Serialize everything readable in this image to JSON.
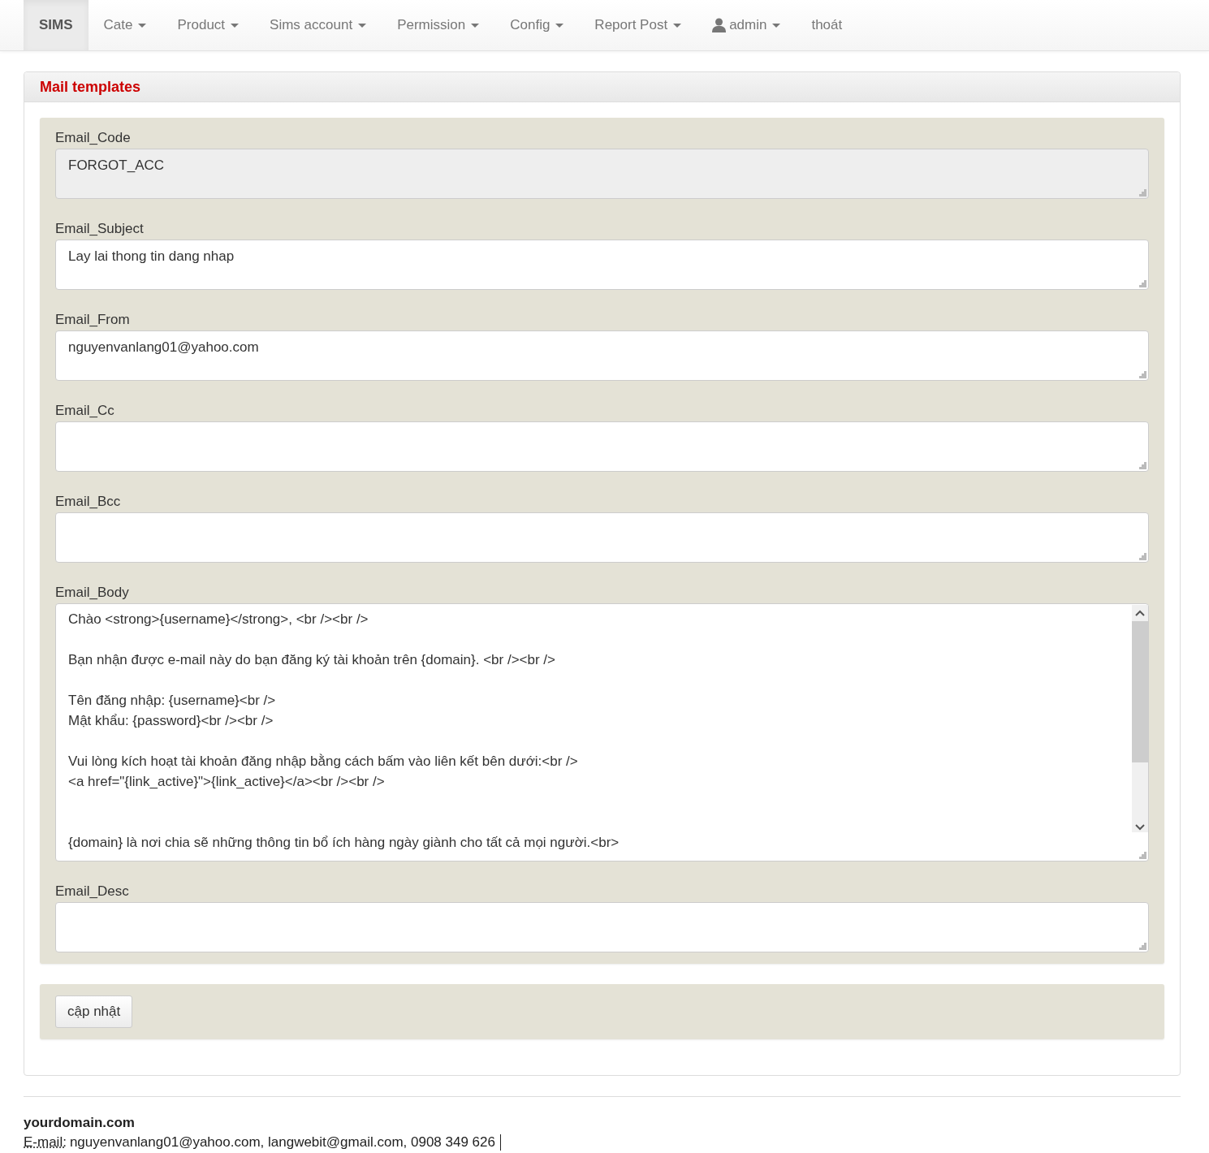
{
  "navbar": {
    "items": [
      {
        "label": "SIMS",
        "kind": "brand",
        "selected": true
      },
      {
        "label": "Cate",
        "kind": "dropdown",
        "selected": false
      },
      {
        "label": "Product",
        "kind": "dropdown",
        "selected": false
      },
      {
        "label": "Sims account",
        "kind": "dropdown",
        "selected": false
      },
      {
        "label": "Permission",
        "kind": "dropdown",
        "selected": false
      },
      {
        "label": "Config",
        "kind": "dropdown",
        "selected": false
      },
      {
        "label": "Report Post",
        "kind": "dropdown",
        "selected": false
      },
      {
        "label": "admin",
        "kind": "user",
        "selected": false
      },
      {
        "label": "thoát",
        "kind": "link",
        "selected": false
      }
    ]
  },
  "panel": {
    "title": "Mail templates",
    "fields": [
      {
        "label": "Email_Code",
        "value": "FORGOT_ACC",
        "disabled": true,
        "kind": "short"
      },
      {
        "label": "Email_Subject",
        "value": "Lay lai thong tin dang nhap",
        "disabled": false,
        "kind": "short"
      },
      {
        "label": "Email_From",
        "value": "nguyenvanlang01@yahoo.com",
        "disabled": false,
        "kind": "short"
      },
      {
        "label": "Email_Cc",
        "disabled": false,
        "kind": "short"
      },
      {
        "label": "Email_Bcc",
        "disabled": false,
        "kind": "short"
      },
      {
        "label": "Email_Body",
        "value": "Chào <strong>{username}</strong>, <br /><br />\n\nBạn nhận được e-mail này do bạn đăng ký tài khoản trên {domain}. <br /><br />\n\nTên đăng nhập: {username}<br />\nMật khẩu: {password}<br /><br />\n\nVui lòng kích hoạt tài khoản đăng nhập bằng cách bấm vào liên kết bên dưới:<br />\n<a href=\"{link_active}\">{link_active}</a><br /><br />\n\n\n{domain} là nơi chia sẽ những thông tin bổ ích hàng ngày giành cho tất cả mọi người.<br>",
        "disabled": false,
        "kind": "scrolling"
      },
      {
        "label": "Email_Desc",
        "disabled": false,
        "kind": "short"
      }
    ],
    "submit": "cập nhật"
  },
  "footer": {
    "site": "yourdomain.com",
    "contact_label": "E-mail:",
    "contact": "nguyenvanlang01@yahoo.com, langwebit@gmail.com, 0908 349 626"
  }
}
